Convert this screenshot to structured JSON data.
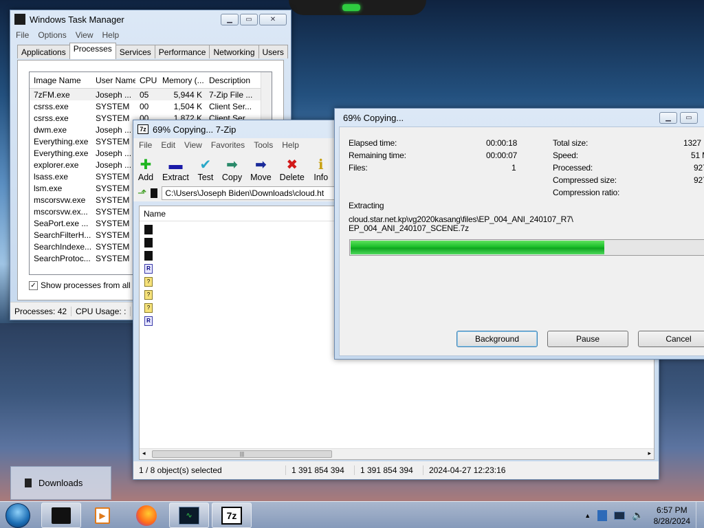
{
  "task_manager": {
    "title": "Windows Task Manager",
    "menu": [
      "File",
      "Options",
      "View",
      "Help"
    ],
    "tabs": [
      "Applications",
      "Processes",
      "Services",
      "Performance",
      "Networking",
      "Users"
    ],
    "active_tab": "Processes",
    "columns": [
      "Image Name",
      "User Name",
      "CPU",
      "Memory (...",
      "Description"
    ],
    "rows": [
      [
        "7zFM.exe",
        "Joseph ...",
        "05",
        "5,944 K",
        "7-Zip File ..."
      ],
      [
        "csrss.exe",
        "SYSTEM",
        "00",
        "1,504 K",
        "Client Ser..."
      ],
      [
        "csrss.exe",
        "SYSTEM",
        "00",
        "1,872 K",
        "Client Ser..."
      ],
      [
        "dwm.exe",
        "Joseph ...",
        "",
        "",
        ""
      ],
      [
        "Everything.exe",
        "SYSTEM",
        "",
        "",
        ""
      ],
      [
        "Everything.exe",
        "Joseph ...",
        "",
        "",
        ""
      ],
      [
        "explorer.exe",
        "Joseph ...",
        "",
        "",
        ""
      ],
      [
        "lsass.exe",
        "SYSTEM",
        "",
        "",
        ""
      ],
      [
        "lsm.exe",
        "SYSTEM",
        "",
        "",
        ""
      ],
      [
        "mscorsvw.exe",
        "SYSTEM",
        "",
        "",
        ""
      ],
      [
        "mscorsvw.ex...",
        "SYSTEM",
        "",
        "",
        ""
      ],
      [
        "SeaPort.exe ...",
        "SYSTEM",
        "",
        "",
        ""
      ],
      [
        "SearchFilterH...",
        "SYSTEM",
        "",
        "",
        ""
      ],
      [
        "SearchIndexe...",
        "SYSTEM",
        "",
        "",
        ""
      ],
      [
        "SearchProtoc...",
        "SYSTEM",
        "",
        "",
        ""
      ]
    ],
    "show_all_label": "Show processes from all use",
    "status_processes": "Processes: 42",
    "status_cpu": "CPU Usage: :"
  },
  "sevenzip": {
    "title": "69% Copying... 7-Zip",
    "menu": [
      "File",
      "Edit",
      "View",
      "Favorites",
      "Tools",
      "Help"
    ],
    "toolbar": [
      {
        "label": "Add",
        "icon": "plus-icon"
      },
      {
        "label": "Extract",
        "icon": "minus-icon"
      },
      {
        "label": "Test",
        "icon": "check-icon"
      },
      {
        "label": "Copy",
        "icon": "copy-arrow-icon"
      },
      {
        "label": "Move",
        "icon": "move-arrow-icon"
      },
      {
        "label": "Delete",
        "icon": "delete-x-icon"
      },
      {
        "label": "Info",
        "icon": "info-icon"
      }
    ],
    "path": "C:\\Users\\Joseph Biden\\Downloads\\cloud.ht",
    "name_column": "Name",
    "files": [
      "dark",
      "dark",
      "dark",
      "R",
      "?",
      "?",
      "?",
      "R"
    ],
    "status_selected": "1 / 8 object(s) selected",
    "status_size": "1 391 854 394",
    "status_size2": "1 391 854 394",
    "status_date": "2024-04-27 12:23:16"
  },
  "progress": {
    "title": "69% Copying...",
    "elapsed_label": "Elapsed time:",
    "elapsed_value": "00:00:18",
    "remaining_label": "Remaining time:",
    "remaining_value": "00:00:07",
    "files_label": "Files:",
    "files_value": "1",
    "total_size_label": "Total size:",
    "total_size_value": "1327",
    "speed_label": "Speed:",
    "speed_value": "51 M",
    "processed_label": "Processed:",
    "processed_value": "927",
    "compressed_label": "Compressed size:",
    "compressed_value": "927",
    "ratio_label": "Compression ratio:",
    "action": "Extracting",
    "file_path_line1": "cloud.star.net.kp\\vg2020kasang\\files\\EP_004_ANI_240107_R7\\",
    "file_path_line2": "EP_004_ANI_240107_SCENE.7z",
    "percent": 69,
    "background_button": "Background",
    "pause_button": "Pause",
    "cancel_button": "Cancel"
  },
  "downloads_tip": "Downloads",
  "taskbar": {
    "time": "6:57 PM",
    "date": "8/28/2024"
  }
}
